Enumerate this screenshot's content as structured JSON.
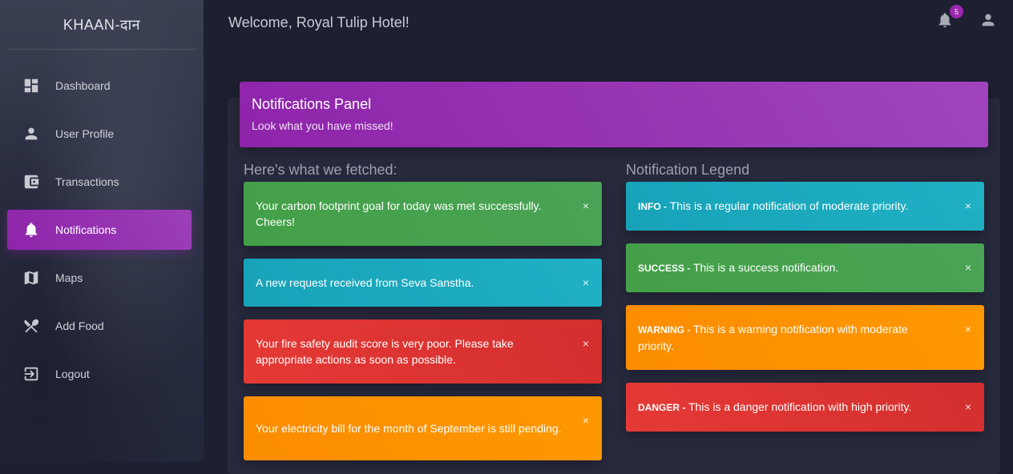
{
  "brand": "KHAAN-दान",
  "sidebar": {
    "items": [
      {
        "label": "Dashboard",
        "icon": "dashboard-icon"
      },
      {
        "label": "User Profile",
        "icon": "person-icon"
      },
      {
        "label": "Transactions",
        "icon": "wallet-icon"
      },
      {
        "label": "Notifications",
        "icon": "bell-icon",
        "active": true
      },
      {
        "label": "Maps",
        "icon": "map-icon"
      },
      {
        "label": "Add Food",
        "icon": "utensils-icon"
      },
      {
        "label": "Logout",
        "icon": "logout-icon"
      }
    ]
  },
  "header": {
    "welcome": "Welcome, Royal Tulip Hotel!",
    "notification_count": "5"
  },
  "panel": {
    "title": "Notifications Panel",
    "subtitle": "Look what you have missed!"
  },
  "fetched": {
    "heading": "Here's what we fetched:",
    "alerts": [
      {
        "type": "success",
        "text": "Your carbon footprint goal for today was met successfully. Cheers!"
      },
      {
        "type": "info",
        "text": "A new request received from Seva Sanstha."
      },
      {
        "type": "danger",
        "text": "Your fire safety audit score is very poor. Please take appropriate actions as soon as possible."
      },
      {
        "type": "warning",
        "text": "Your electricity bill for the month of September is still pending."
      }
    ]
  },
  "legend": {
    "heading": "Notification Legend",
    "items": [
      {
        "type": "info",
        "label": "INFO -",
        "text": "This is a regular notification of moderate priority."
      },
      {
        "type": "success",
        "label": "SUCCESS -",
        "text": "This is a success notification."
      },
      {
        "type": "warning",
        "label": "WARNING -",
        "text": "This is a warning notification with moderate priority."
      },
      {
        "type": "danger",
        "label": "DANGER -",
        "text": "This is a danger notification with high priority."
      }
    ]
  },
  "close_symbol": "×",
  "colors": {
    "accent": "#9c27b0",
    "success": "#43a047",
    "info": "#17a2b8",
    "danger": "#e53935",
    "warning": "#fb8c00"
  }
}
